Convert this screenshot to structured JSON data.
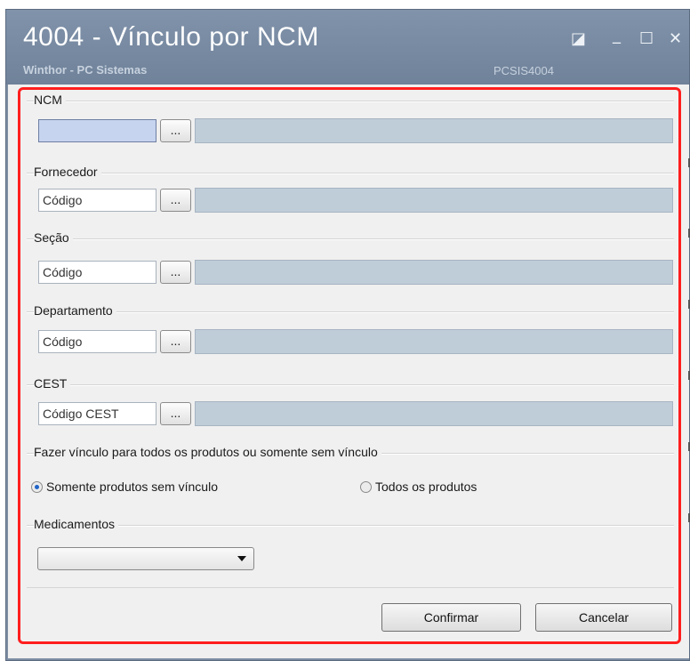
{
  "window": {
    "title": "4004 - Vínculo por NCM",
    "subtitle": "Winthor - PC Sistemas",
    "code": "PCSIS4004",
    "controls": {
      "restore": "◪",
      "minimize": "_",
      "maximize": "☐",
      "close": "✕"
    }
  },
  "groups": {
    "ncm": {
      "label": "NCM",
      "value": "",
      "placeholder": "",
      "lookup": "..."
    },
    "fornecedor": {
      "label": "Fornecedor",
      "value": "Código",
      "lookup": "..."
    },
    "secao": {
      "label": "Seção",
      "value": "Código",
      "lookup": "..."
    },
    "departamento": {
      "label": "Departamento",
      "value": "Código",
      "lookup": "..."
    },
    "cest": {
      "label": "CEST",
      "value": "Código CEST",
      "lookup": "..."
    }
  },
  "vinculo": {
    "label": "Fazer vínculo para todos os produtos ou somente sem vínculo",
    "option_sem_vinculo": "Somente produtos sem vínculo",
    "option_todos": "Todos os produtos",
    "selected": "Somente produtos sem vínculo"
  },
  "medicamentos": {
    "label": "Medicamentos",
    "selected": ""
  },
  "actions": {
    "confirm": "Confirmar",
    "cancel": "Cancelar"
  },
  "colors": {
    "titlebar": "#7d8da3",
    "highlight": "#ff1e1e",
    "active_input": "#c6d4ef",
    "description_field": "#bfcdd9"
  }
}
